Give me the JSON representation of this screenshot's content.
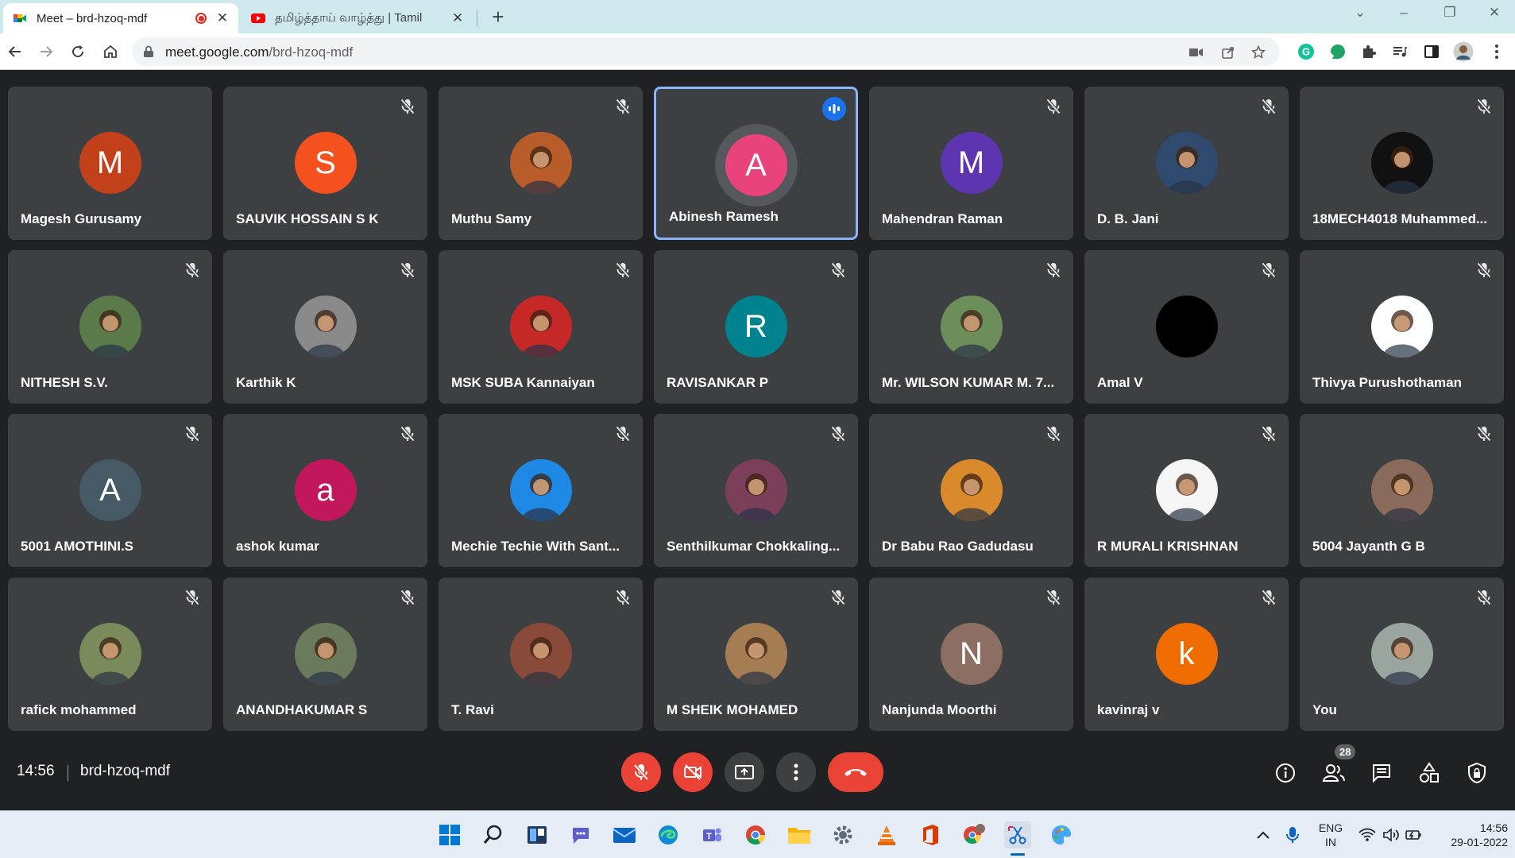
{
  "browser": {
    "tabs": [
      {
        "title": "Meet – brd-hzoq-mdf",
        "active": true,
        "recording": true
      },
      {
        "title": "தமிழ்த்தாய் வாழ்த்து | Tamil",
        "active": false
      }
    ],
    "url_host": "meet.google.com",
    "url_path": "/brd-hzoq-mdf"
  },
  "participants": [
    {
      "name": "Magesh Gurusamy",
      "initial": "M",
      "color": "#c2411a",
      "muted": false,
      "photo": false
    },
    {
      "name": "SAUVIK HOSSAIN S K",
      "initial": "S",
      "color": "#f4511e",
      "muted": true,
      "photo": false
    },
    {
      "name": "Muthu Samy",
      "initial": "",
      "color": "#b85c2a",
      "muted": true,
      "photo": true
    },
    {
      "name": "Abinesh Ramesh",
      "initial": "A",
      "color": "#e8437a",
      "muted": false,
      "speaking": true,
      "photo": false
    },
    {
      "name": "Mahendran Raman",
      "initial": "M",
      "color": "#5e35b1",
      "muted": true,
      "photo": false
    },
    {
      "name": "D. B. Jani",
      "initial": "",
      "color": "#2f4a6e",
      "muted": true,
      "photo": true
    },
    {
      "name": "18MECH4018 Muhammed...",
      "initial": "",
      "color": "#111111",
      "muted": true,
      "photo": true
    },
    {
      "name": "NITHESH S.V.",
      "initial": "",
      "color": "#5a7a4a",
      "muted": true,
      "photo": true
    },
    {
      "name": "Karthik K",
      "initial": "",
      "color": "#8a8a8a",
      "muted": true,
      "photo": true
    },
    {
      "name": "MSK SUBA Kannaiyan",
      "initial": "",
      "color": "#c62828",
      "muted": true,
      "photo": true
    },
    {
      "name": "RAVISANKAR P",
      "initial": "R",
      "color": "#00838f",
      "muted": true,
      "photo": false
    },
    {
      "name": "Mr. WILSON KUMAR M. 7...",
      "initial": "",
      "color": "#6b8e5a",
      "muted": true,
      "photo": true
    },
    {
      "name": "Amal V",
      "initial": "",
      "color": "#000000",
      "muted": true,
      "photo": false
    },
    {
      "name": "Thivya Purushothaman",
      "initial": "",
      "color": "#ffffff",
      "muted": true,
      "photo": true
    },
    {
      "name": "5001 AMOTHINI.S",
      "initial": "A",
      "color": "#455a64",
      "muted": true,
      "photo": false
    },
    {
      "name": "ashok kumar",
      "initial": "a",
      "color": "#c2185b",
      "muted": true,
      "photo": false
    },
    {
      "name": "Mechie Techie With Sant...",
      "initial": "",
      "color": "#1e88e5",
      "muted": true,
      "photo": true
    },
    {
      "name": "Senthilkumar Chokkaling...",
      "initial": "",
      "color": "#7b3f5a",
      "muted": true,
      "photo": true
    },
    {
      "name": "Dr Babu Rao Gadudasu",
      "initial": "",
      "color": "#d98a2b",
      "muted": true,
      "photo": true
    },
    {
      "name": "R MURALI KRISHNAN",
      "initial": "",
      "color": "#f5f5f5",
      "muted": true,
      "photo": true
    },
    {
      "name": "5004 Jayanth G B",
      "initial": "",
      "color": "#8a6a5a",
      "muted": true,
      "photo": true
    },
    {
      "name": "rafick mohammed",
      "initial": "",
      "color": "#7a8a5a",
      "muted": true,
      "photo": true
    },
    {
      "name": "ANANDHAKUMAR S",
      "initial": "",
      "color": "#6a7a5a",
      "muted": true,
      "photo": true
    },
    {
      "name": "T. Ravi",
      "initial": "",
      "color": "#8a4a3a",
      "muted": true,
      "photo": true
    },
    {
      "name": "M SHEIK MOHAMED",
      "initial": "",
      "color": "#a67c52",
      "muted": true,
      "photo": true
    },
    {
      "name": "Nanjunda Moorthi",
      "initial": "N",
      "color": "#8d6e63",
      "muted": true,
      "photo": false
    },
    {
      "name": "kavinraj v",
      "initial": "k",
      "color": "#ef6c00",
      "muted": true,
      "photo": false
    },
    {
      "name": "You",
      "initial": "",
      "color": "#9aa5a0",
      "muted": true,
      "photo": true
    }
  ],
  "meeting": {
    "time": "14:56",
    "code": "brd-hzoq-mdf",
    "people_count": "28"
  },
  "taskbar": {
    "lang_line1": "ENG",
    "lang_line2": "IN",
    "time": "14:56",
    "date": "29-01-2022"
  }
}
